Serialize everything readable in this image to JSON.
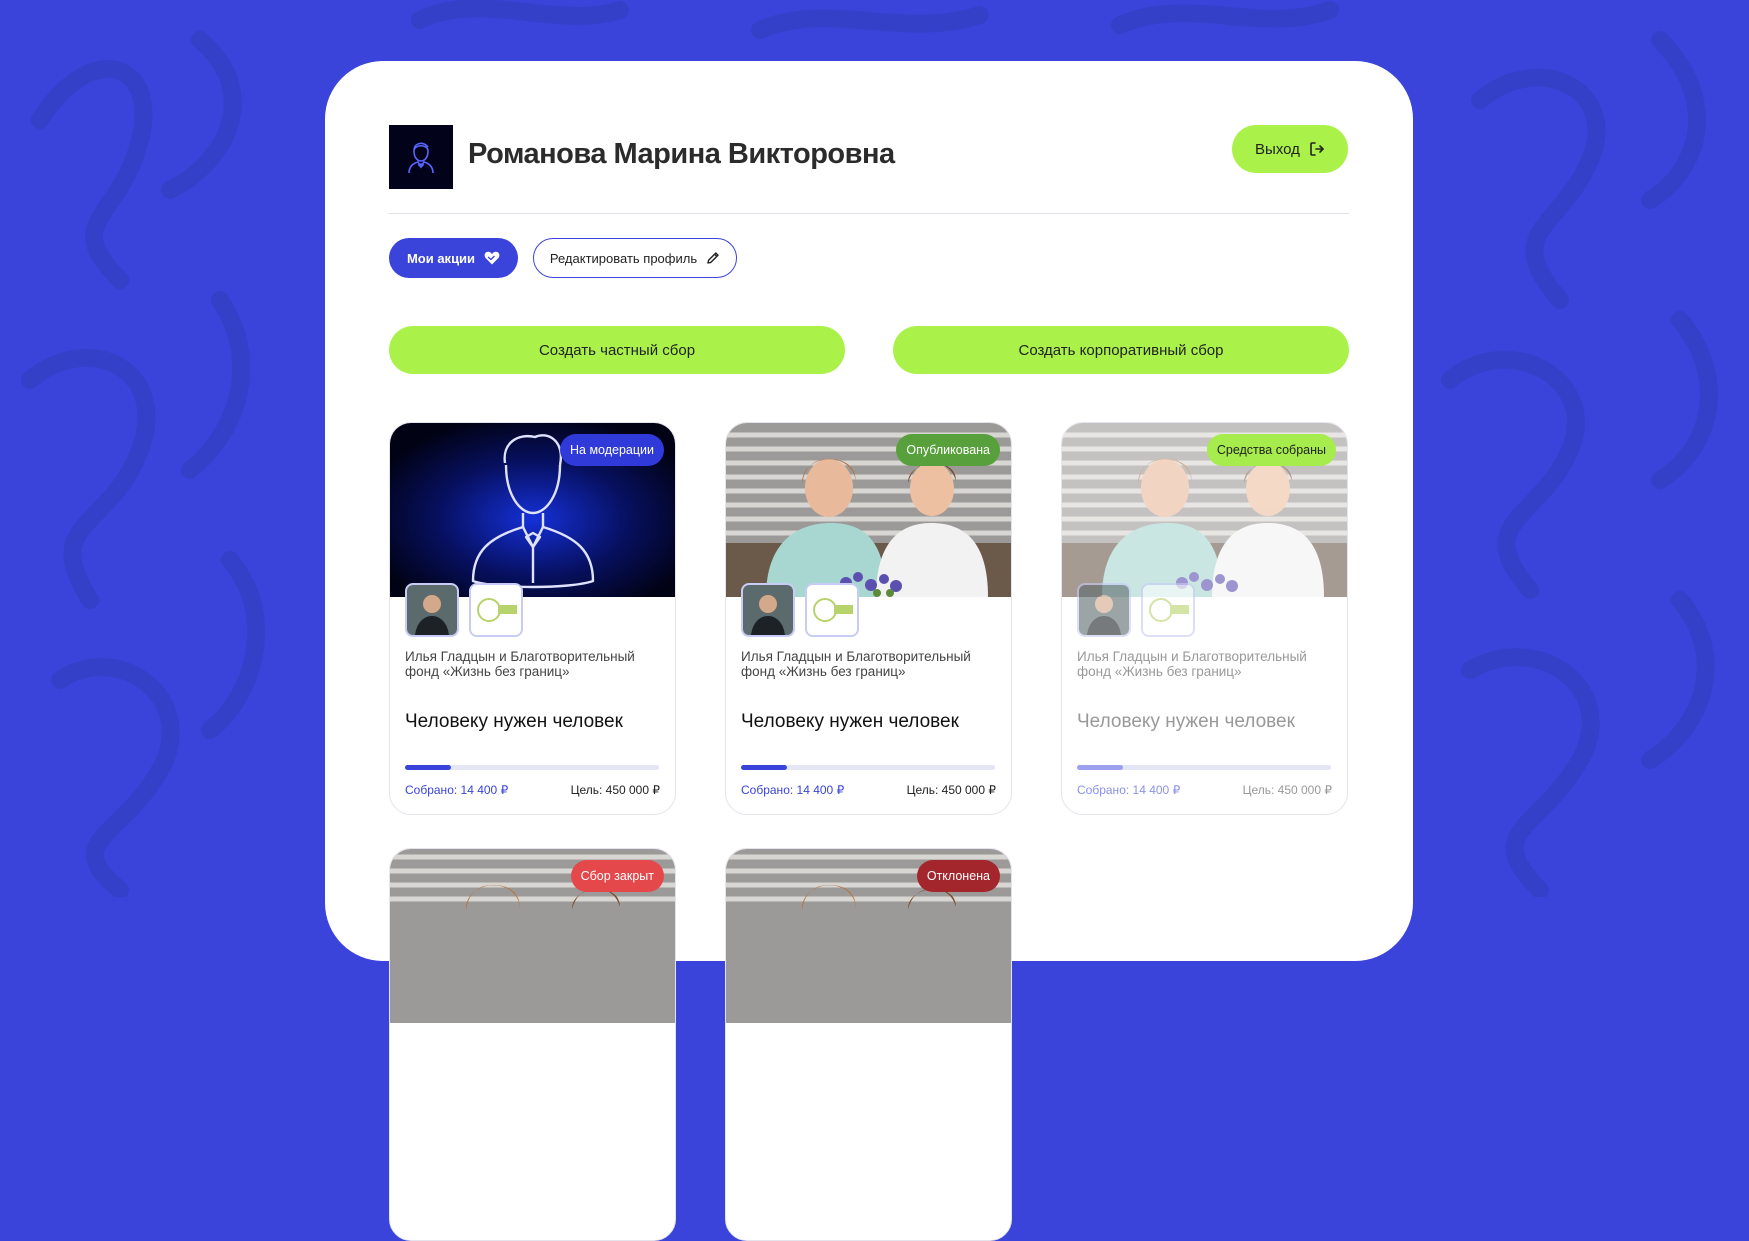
{
  "user": {
    "name": "Романова Марина Викторовна"
  },
  "header": {
    "logout_label": "Выход"
  },
  "tabs": {
    "my_actions": "Мои акции",
    "edit_profile": "Редактировать профиль"
  },
  "actions": {
    "create_private": "Создать частный сбор",
    "create_corporate": "Создать корпоративный сбор"
  },
  "colors": {
    "brand_blue": "#3a44db",
    "accent_green": "#aaf24a"
  },
  "cards": [
    {
      "status": "На модерации",
      "status_color": "#2f3ad8",
      "image": "neon-avatar",
      "organizers": "Илья Гладцын и Благотворительный фонд «Жизнь без границ»",
      "title": "Человеку нужен человек",
      "collected": "Собрано: 14 400 ₽",
      "goal": "Цель: 450 000 ₽",
      "progress_fraction": 0.18,
      "faded": false
    },
    {
      "status": "Опубликована",
      "status_color": "#58a03c",
      "image": "photo-teens",
      "organizers": "Илья Гладцын и Благотворительный фонд «Жизнь без границ»",
      "title": "Человеку нужен человек",
      "collected": "Собрано: 14 400 ₽",
      "goal": "Цель: 450 000 ₽",
      "progress_fraction": 0.18,
      "faded": false
    },
    {
      "status": "Средства собраны",
      "status_color": "#a6ec4c",
      "image": "photo-teens",
      "organizers": "Илья Гладцын и Благотворительный фонд «Жизнь без границ»",
      "title": "Человеку нужен человек",
      "collected": "Собрано: 14 400 ₽",
      "goal": "Цель: 450 000 ₽",
      "progress_fraction": 0.18,
      "faded": true
    },
    {
      "status": "Сбор закрыт",
      "status_color": "#e4484b",
      "image": "photo-teens",
      "faded": false
    },
    {
      "status": "Отклонена",
      "status_color": "#a3262d",
      "image": "photo-teens",
      "faded": false
    }
  ]
}
